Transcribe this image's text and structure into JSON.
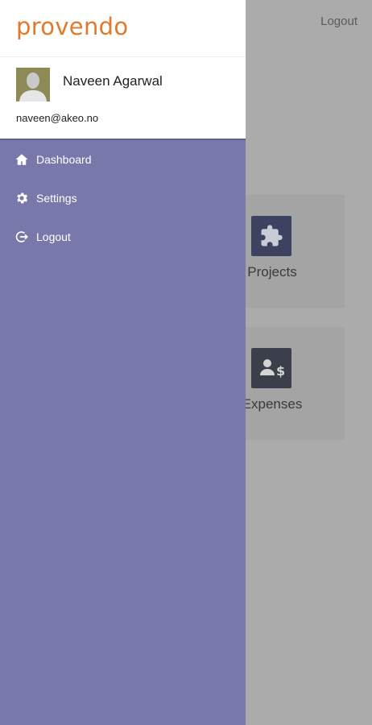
{
  "background": {
    "logout_label": "Logout",
    "tiles": [
      {
        "label": "Projects",
        "icon": "puzzle-icon"
      },
      {
        "label": "Expenses",
        "icon": "user-dollar-icon"
      }
    ]
  },
  "drawer": {
    "logo": "provendo",
    "user": {
      "name": "Naveen Agarwal",
      "email": "naveen@akeo.no",
      "avatar_icon": "avatar-placeholder-icon"
    },
    "menu": [
      {
        "label": "Dashboard",
        "icon": "home-icon"
      },
      {
        "label": "Settings",
        "icon": "gear-icon"
      },
      {
        "label": "Logout",
        "icon": "logout-icon"
      }
    ]
  },
  "colors": {
    "brand": "#e07a2c",
    "drawer_bg": "#7878aa",
    "overlay": "#ababab"
  }
}
